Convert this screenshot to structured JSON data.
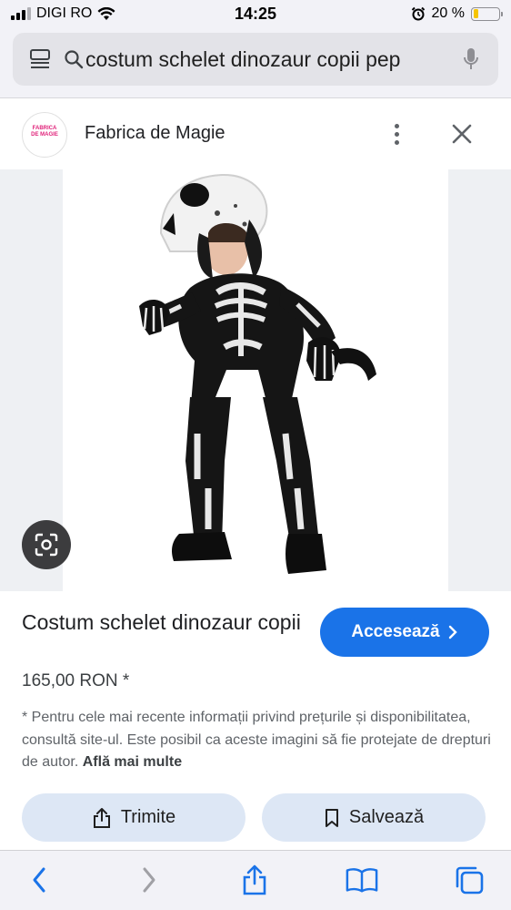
{
  "status_bar": {
    "carrier": "DIGI RO",
    "time": "14:25",
    "battery": "20 %",
    "battery_level": 0.2
  },
  "search": {
    "query": "costum schelet dinozaur copii pep"
  },
  "source": {
    "name": "Fabrica de Magie",
    "logo_text": "FABRICA DE MAGIE"
  },
  "product": {
    "title": "Costum schelet dinozaur copii",
    "price": "165,00 RON *",
    "visit_label": "Accesează",
    "disclaimer": "* Pentru cele mai recente informații privind prețurile și disponibilitatea, consultă site-ul. Este posibil ca aceste imagini să fie protejate de drepturi de autor.",
    "learn_more": "Află mai multe"
  },
  "actions": {
    "share_label": "Trimite",
    "save_label": "Salvează"
  },
  "colors": {
    "accent": "#1a73e8",
    "action_bg": "#dde7f5",
    "toolbar_icon": "#1a73e8"
  },
  "icons": [
    "signal-icon",
    "wifi-icon",
    "alarm-icon",
    "battery-icon",
    "search-icon",
    "mic-icon",
    "more-vert-icon",
    "close-icon",
    "lens-icon",
    "chevron-right-icon",
    "share-icon",
    "bookmark-icon",
    "back-icon",
    "forward-icon",
    "book-icon",
    "tabs-icon"
  ]
}
